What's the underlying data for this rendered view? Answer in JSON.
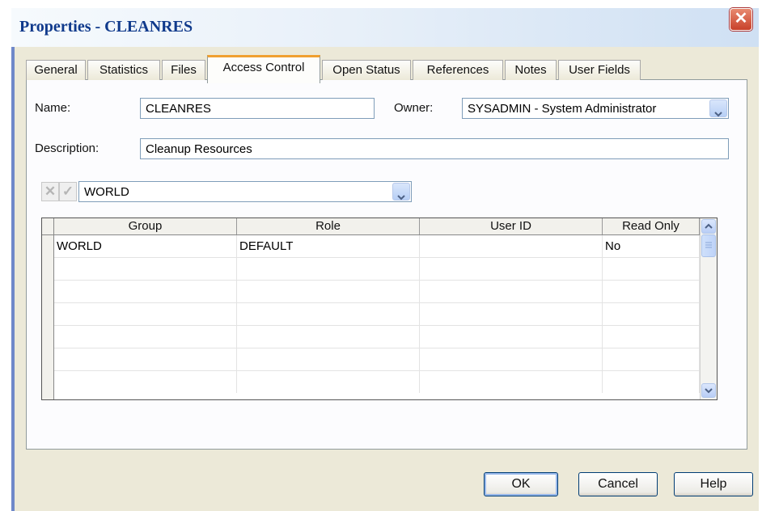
{
  "window": {
    "title": "Properties - CLEANRES",
    "close_glyph": "✕"
  },
  "tabs": [
    {
      "label": "General"
    },
    {
      "label": "Statistics"
    },
    {
      "label": "Files"
    },
    {
      "label": "Access Control",
      "active": true
    },
    {
      "label": "Open Status"
    },
    {
      "label": "References"
    },
    {
      "label": "Notes"
    },
    {
      "label": "User Fields"
    }
  ],
  "form": {
    "name_label": "Name:",
    "name_value": "CLEANRES",
    "owner_label": "Owner:",
    "owner_value": "SYSADMIN - System Administrator",
    "description_label": "Description:",
    "description_value": "Cleanup Resources"
  },
  "access_toolbar": {
    "cancel_icon": "x-icon",
    "confirm_icon": "check-icon",
    "group_select_value": "WORLD"
  },
  "grid": {
    "columns": [
      "Group",
      "Role",
      "User ID",
      "Read Only"
    ],
    "rows": [
      [
        "WORLD",
        "DEFAULT",
        "",
        "No"
      ],
      [
        "",
        "",
        "",
        ""
      ],
      [
        "",
        "",
        "",
        ""
      ],
      [
        "",
        "",
        "",
        ""
      ],
      [
        "",
        "",
        "",
        ""
      ],
      [
        "",
        "",
        "",
        ""
      ],
      [
        "",
        "",
        "",
        ""
      ]
    ]
  },
  "buttons": {
    "ok": "OK",
    "cancel": "Cancel",
    "help": "Help"
  },
  "colors": {
    "title_text": "#103a8c",
    "close_button": "#c8412a",
    "active_tab_accent": "#f0a030",
    "dialog_face": "#ece9d8"
  }
}
